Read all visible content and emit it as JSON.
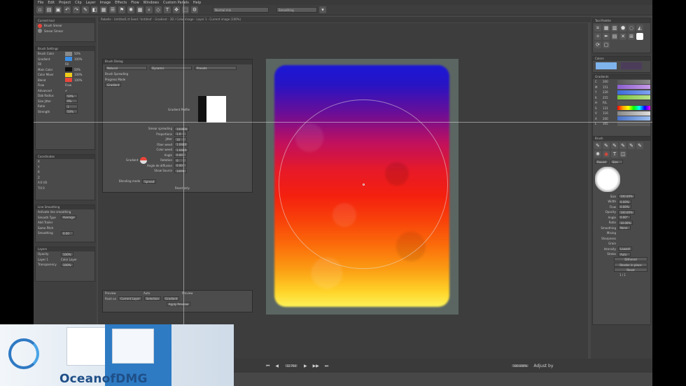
{
  "menu": [
    "File",
    "Edit",
    "Project",
    "Clip",
    "Layer",
    "Image",
    "Effects",
    "Flow",
    "Windows",
    "Custom Panels",
    "Help"
  ],
  "toolbar": {
    "blend_mode": "Normal mix",
    "preset": "Smoothing"
  },
  "document_tab": "Rebelle - Untitled1.tt Seed: 'Untitled' - Gradient - 3D / Color image - Layer 1 - Current image (100%)",
  "left_dock": {
    "panel1_title": "Current tool",
    "tool_items": [
      "Brush Smear",
      "Smear Smear"
    ],
    "panel2_title": "Brush Settings",
    "brush_rows": [
      {
        "label": "Brush Color",
        "value": "50%"
      },
      {
        "label": "Gradient",
        "value": "100%"
      },
      {
        "label": "Fill",
        "value": "Fill"
      },
      {
        "label": "Main Color",
        "value": "50%"
      },
      {
        "label": "Color Mixer",
        "value": "100%"
      },
      {
        "label": "Blend",
        "value": "100%"
      },
      {
        "label": "Flow",
        "value": "Flow"
      },
      {
        "label": "Advanced",
        "value": "✔"
      },
      {
        "label": "Dab Radius",
        "value": "50%"
      },
      {
        "label": "Size Jitter",
        "value": "0%"
      },
      {
        "label": "Ratio",
        "value": "1"
      },
      {
        "label": "Strength",
        "value": "50%"
      }
    ],
    "panel3_title": "Coordinates",
    "coords": [
      "X",
      "Y",
      "R",
      "Z",
      "A:0 (0)",
      "T:0 0"
    ],
    "panel4_title": "Line Smoothing",
    "smoothing_rows": [
      {
        "label": "Activate line smoothing",
        "value": ""
      },
      {
        "label": "Smooth Type",
        "value": "Average"
      },
      {
        "label": "Add Trailer",
        "value": ""
      },
      {
        "label": "Same Pitch",
        "value": ""
      },
      {
        "label": "Smoothing",
        "value": "0.00"
      }
    ],
    "panel5_title": "Layers",
    "layer_rows": [
      {
        "label": "Opacity",
        "value": "100%"
      },
      {
        "label": "Layer 1",
        "value": "Color Layer"
      },
      {
        "label": "Transparency",
        "value": "100%"
      }
    ]
  },
  "dialog": {
    "title": "Brush Dialog",
    "tabs": [
      "Natural",
      "Dynamic",
      "Presets"
    ],
    "section": "Brush Spreading",
    "sub": "Progress Mode",
    "sub2": "Gradient",
    "preview_label": "Gradient Profile",
    "rows": [
      {
        "label": "Smear spreading",
        "value": "100000"
      },
      {
        "label": "Proportions",
        "value": "1.0"
      },
      {
        "label": "Jitter",
        "value": "10"
      },
      {
        "label": "Fiber weed",
        "value": "1.0444"
      },
      {
        "label": "Color weed",
        "value": "1.0444"
      },
      {
        "label": "Angle",
        "value": "0.00"
      },
      {
        "label": "Rotation",
        "value": "0"
      },
      {
        "label": "Angle de diffusion",
        "value": "0.00"
      },
      {
        "label": "Show Source",
        "value": "100%"
      }
    ],
    "color_label": "Gradient",
    "blend_label": "Blending mode",
    "blend_value": "Spread",
    "reset": "Reset only"
  },
  "low_panel": {
    "labels": [
      "Preview",
      "Auto",
      "Preview"
    ],
    "row2": [
      "Paint on",
      "Current Layer",
      "Selection",
      "Gradient"
    ],
    "button": "Apply Preview"
  },
  "right_dock": {
    "nav_title": "Tool Palette",
    "color_title": "Colors",
    "gradient_title": "Gradients",
    "gradient_rows": [
      {
        "label": "C",
        "value": "200"
      },
      {
        "label": "M",
        "value": "151"
      },
      {
        "label": "Y",
        "value": "226"
      },
      {
        "label": "K",
        "value": "255"
      },
      {
        "label": "H",
        "value": "R/L"
      },
      {
        "label": "S",
        "value": "131"
      },
      {
        "label": "V",
        "value": "116"
      },
      {
        "label": "A",
        "value": "200"
      },
      {
        "label": "L",
        "value": "305"
      }
    ],
    "brush_title": "Brush",
    "brush_name": "Round",
    "brush_size": "Size",
    "brush_rows": [
      {
        "label": "Size",
        "value": "100.00%"
      },
      {
        "label": "Width",
        "value": "0.00%"
      },
      {
        "label": "Flow",
        "value": "0.00%"
      },
      {
        "label": "Opacity",
        "value": "100.00%"
      },
      {
        "label": "Angle",
        "value": "0.00°"
      },
      {
        "label": "Ratio",
        "value": "10.00%"
      },
      {
        "label": "Smoothing",
        "value": "None"
      },
      {
        "label": "Mixing",
        "value": ""
      },
      {
        "label": "Sharpness",
        "value": ""
      },
      {
        "label": "Grain",
        "value": ""
      },
      {
        "label": "Intensity",
        "value": "Lowest"
      },
      {
        "label": "Stroke",
        "value": "Auto"
      }
    ],
    "buttons": [
      "Dithered",
      "Render in place",
      "Reset"
    ],
    "page": "1 / 1"
  },
  "bottom": {
    "zoom": "32.794",
    "pos": "100.000%",
    "label": "Adjust by"
  },
  "watermark": "OceanofDMG",
  "colors": {
    "accent": "#3a8ee6",
    "red": "#e8463a",
    "yellow": "#f0cc1a"
  }
}
